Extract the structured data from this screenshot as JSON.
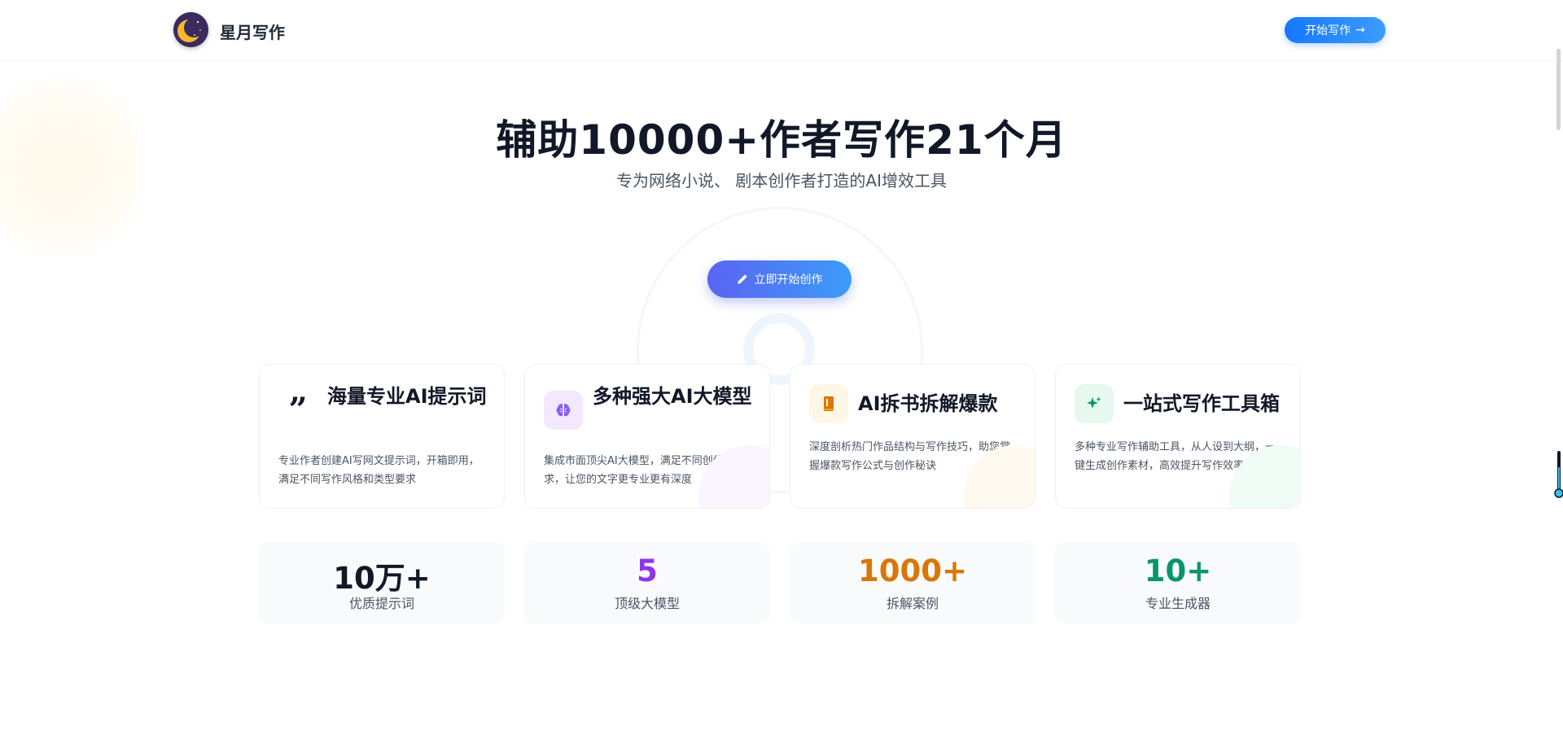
{
  "header": {
    "brand": "星月写作",
    "start_button": "开始写作",
    "logo_icon": "moon-logo-icon",
    "arrow_icon": "arrow-right-icon"
  },
  "hero": {
    "title": "辅助10000+作者写作21个月",
    "subtitle": "专为网络小说、 剧本创作者打造的AI增效工具",
    "cta_label": "立即开始创作",
    "cta_icon": "pencil-icon"
  },
  "features": [
    {
      "icon": "quote-icon",
      "title": "海量专业AI提示词",
      "desc": "专业作者创建AI写网文提示词，开箱即用，满足不同写作风格和类型要求",
      "accent": "#111827"
    },
    {
      "icon": "brain-icon",
      "title": "多种强大AI大模型",
      "desc": "集成市面顶尖AI大模型，满足不同创作需求，让您的文字更专业更有深度",
      "accent": "#8b5cf6"
    },
    {
      "icon": "book-icon",
      "title": "AI拆书拆解爆款",
      "desc": "深度剖析热门作品结构与写作技巧，助您掌握爆款写作公式与创作秘诀",
      "accent": "#f59e0b"
    },
    {
      "icon": "sparkle-icon",
      "title": "一站式写作工具箱",
      "desc": "多种专业写作辅助工具，从人设到大纲，一键生成创作素材，高效提升写作效率",
      "accent": "#10b981"
    }
  ],
  "stats": [
    {
      "value": "10万+",
      "label": "优质提示词",
      "color": "#111827"
    },
    {
      "value": "5",
      "label": "顶级大模型",
      "color": "#9333ea"
    },
    {
      "value": "1000+",
      "label": "拆解案例",
      "color": "#d97706"
    },
    {
      "value": "10+",
      "label": "专业生成器",
      "color": "#059669"
    }
  ]
}
